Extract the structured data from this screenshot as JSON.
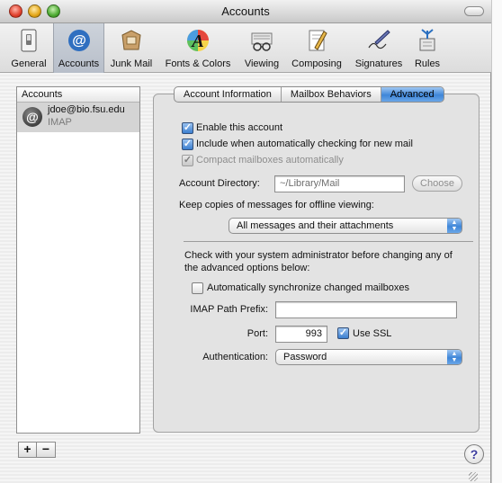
{
  "window": {
    "title": "Accounts"
  },
  "toolbar": {
    "items": [
      {
        "label": "General",
        "icon": "switch-icon"
      },
      {
        "label": "Accounts",
        "icon": "at-sign-icon",
        "selected": true
      },
      {
        "label": "Junk Mail",
        "icon": "junk-mail-icon"
      },
      {
        "label": "Fonts & Colors",
        "icon": "font-icon"
      },
      {
        "label": "Viewing",
        "icon": "glasses-icon"
      },
      {
        "label": "Composing",
        "icon": "pencil-paper-icon"
      },
      {
        "label": "Signatures",
        "icon": "signature-pen-icon"
      },
      {
        "label": "Rules",
        "icon": "rules-icon"
      }
    ]
  },
  "sidebar": {
    "header": "Accounts",
    "accounts": [
      {
        "name": "jdoe@bio.fsu.edu",
        "type": "IMAP",
        "icon": "at-sign-icon"
      }
    ]
  },
  "tabs": [
    {
      "label": "Account Information"
    },
    {
      "label": "Mailbox Behaviors"
    },
    {
      "label": "Advanced",
      "active": true
    }
  ],
  "advanced": {
    "enable_account": {
      "label": "Enable this account",
      "checked": true
    },
    "include_checking": {
      "label": "Include when automatically checking for new mail",
      "checked": true
    },
    "compact_mailboxes": {
      "label": "Compact mailboxes automatically",
      "checked": true,
      "disabled": true
    },
    "account_directory": {
      "label": "Account Directory:",
      "value": "~/Library/Mail",
      "choose_label": "Choose"
    },
    "keep_copies": {
      "label": "Keep copies of messages for offline viewing:",
      "selected": "All messages and their attachments"
    },
    "admin_note": "Check with your system administrator before changing any of the advanced options below:",
    "auto_sync": {
      "label": "Automatically synchronize changed mailboxes",
      "checked": false
    },
    "imap_path_prefix": {
      "label": "IMAP Path Prefix:",
      "value": ""
    },
    "port": {
      "label": "Port:",
      "value": "993"
    },
    "use_ssl": {
      "label": "Use SSL",
      "checked": true
    },
    "authentication": {
      "label": "Authentication:",
      "selected": "Password"
    }
  },
  "help": "?",
  "add_label": "+",
  "remove_label": "−",
  "colors": {
    "accent": "#3f86d8",
    "selection": "#d4d4d4"
  }
}
